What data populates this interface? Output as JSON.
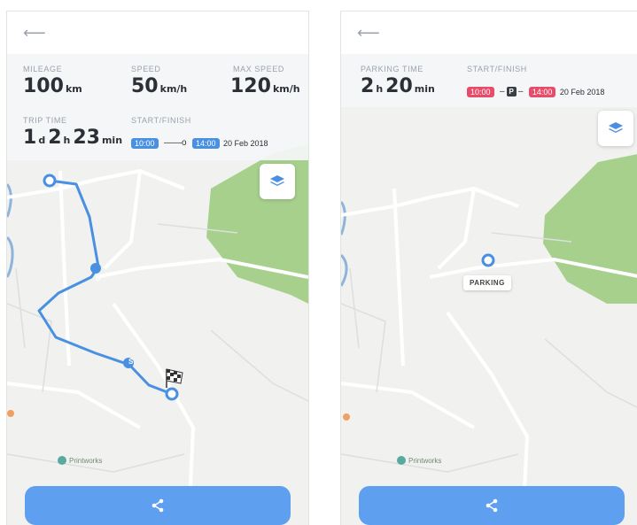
{
  "trip": {
    "back_icon": "arrow-left-icon",
    "mileage": {
      "label": "MILEAGE",
      "value": "100",
      "unit": "km"
    },
    "speed": {
      "label": "SPEED",
      "value": "50",
      "unit": "km/h"
    },
    "max_speed": {
      "label": "MAX SPEED",
      "value": "120",
      "unit": "km/h"
    },
    "trip_time": {
      "label": "TRIP TIME",
      "d": "1",
      "d_unit": "d",
      "h": "2",
      "h_unit": "h",
      "m": "23",
      "m_unit": "min"
    },
    "start_finish": {
      "label": "START/FINISH",
      "start": "10:00",
      "end": "14:00",
      "date": "20 Feb 2018"
    },
    "route_markers": [
      "S",
      "S"
    ],
    "poi_label": "Printworks",
    "layers_icon": "layers-icon",
    "share_icon": "share-icon"
  },
  "parking": {
    "back_icon": "arrow-left-icon",
    "parking_time": {
      "label": "PARKING TIME",
      "h": "2",
      "h_unit": "h",
      "m": "20",
      "m_unit": "min"
    },
    "start_finish": {
      "label": "START/FINISH",
      "start": "10:00",
      "badge": "P",
      "end": "14:00",
      "date": "20 Feb 2018"
    },
    "parking_tag": "PARKING",
    "poi_label": "Printworks",
    "layers_icon": "layers-icon",
    "share_icon": "share-icon"
  },
  "colors": {
    "accent": "#4a90e2",
    "route": "#4a90e2",
    "button": "#5e9ff0",
    "park": "#a6d08c",
    "red_badge": "#e84c6b"
  }
}
